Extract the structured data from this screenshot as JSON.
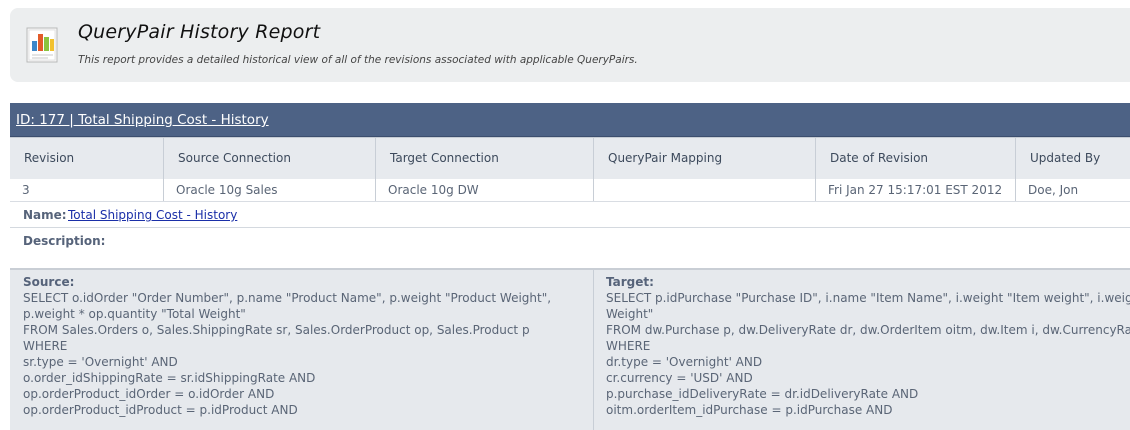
{
  "report": {
    "title": "QueryPair History Report",
    "description": "This report provides a detailed historical view of all of the revisions associated with applicable QueryPairs.",
    "icon": "bar-chart-report-icon"
  },
  "panel": {
    "title": "ID: 177 | Total Shipping Cost - History"
  },
  "table": {
    "columns": [
      "Revision",
      "Source Connection",
      "Target Connection",
      "QueryPair Mapping",
      "Date of Revision",
      "Updated By"
    ],
    "rows": [
      [
        "3",
        "Oracle 10g Sales",
        "Oracle 10g DW",
        "",
        "Fri Jan 27 15:17:01 EST 2012",
        "Doe, Jon"
      ]
    ]
  },
  "details": {
    "name_label": "Name:",
    "name_value": "Total Shipping Cost - History",
    "description_label": "Description:",
    "description_value": ""
  },
  "source": {
    "label": "Source:",
    "lines": [
      "SELECT o.idOrder \"Order Number\", p.name \"Product Name\", p.weight \"Product Weight\",",
      "p.weight * op.quantity \"Total Weight\"",
      "FROM Sales.Orders o, Sales.ShippingRate sr, Sales.OrderProduct op, Sales.Product p",
      "WHERE",
      "sr.type = 'Overnight' AND",
      "o.order_idShippingRate = sr.idShippingRate AND",
      "op.orderProduct_idOrder = o.idOrder AND",
      "op.orderProduct_idProduct = p.idProduct AND"
    ]
  },
  "target": {
    "label": "Target:",
    "lines": [
      "SELECT p.idPurchase \"Purchase ID\", i.name \"Item Name\", i.weight \"Item weight\", i.weight",
      "Weight\"",
      "FROM dw.Purchase p, dw.DeliveryRate dr, dw.OrderItem oitm, dw.Item i, dw.CurrencyRate",
      "WHERE",
      "dr.type = 'Overnight' AND",
      "cr.currency = 'USD' AND",
      "p.purchase_idDeliveryRate = dr.idDeliveryRate AND",
      "oitm.orderItem_idPurchase = p.idPurchase AND"
    ]
  },
  "colors": {
    "title_bar": "#4d6285",
    "header_bg": "#eceeef",
    "grid_header_bg": "#e7eaee",
    "sql_bg": "#e6e9ed",
    "link": "#1a2fa8"
  }
}
